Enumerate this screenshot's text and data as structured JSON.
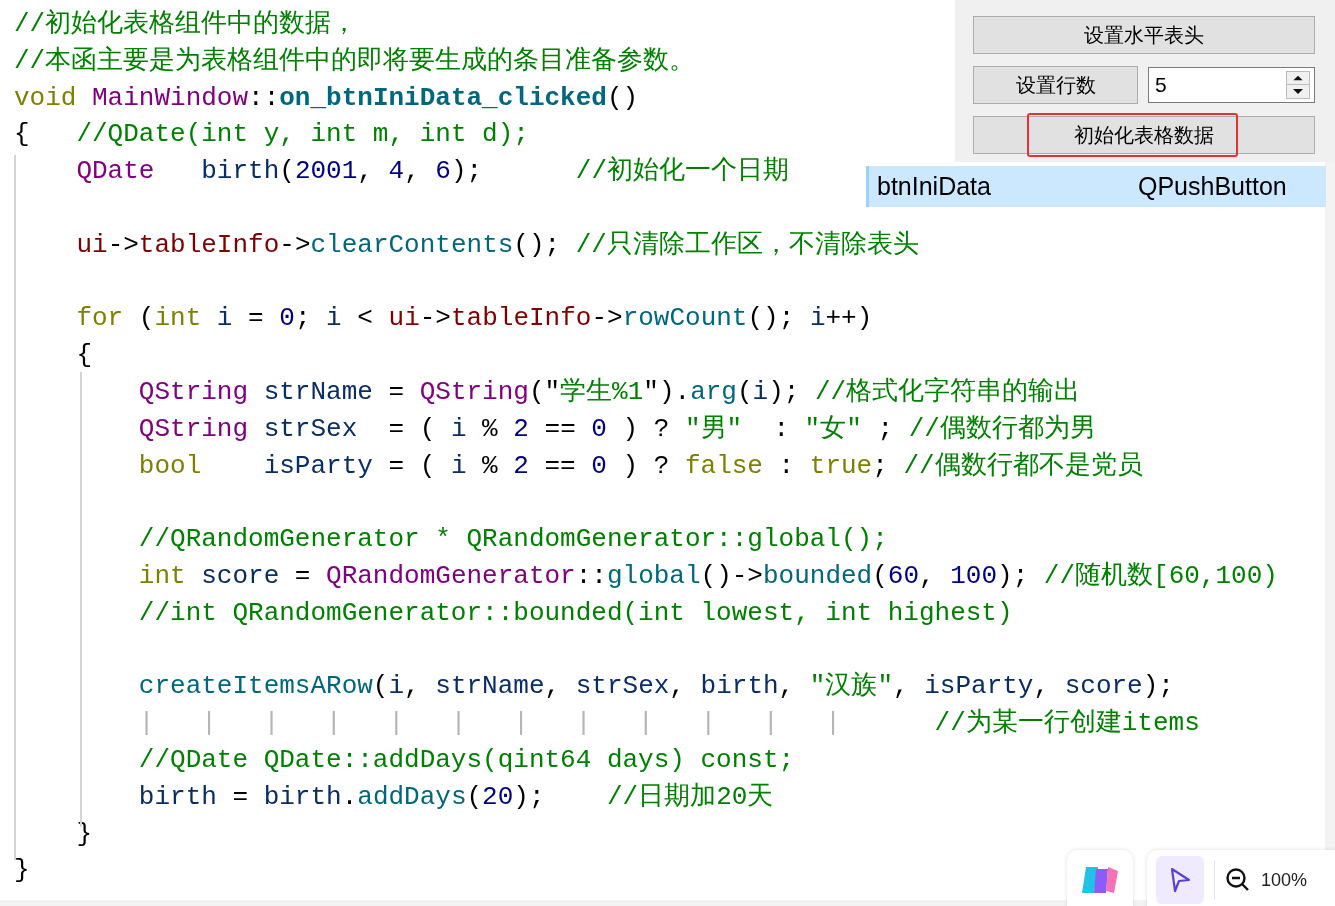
{
  "code": {
    "lines": [
      {
        "kind": "code",
        "tokens": [
          {
            "text": "//初始化表格组件中的数据，",
            "kind": "comment"
          }
        ]
      },
      {
        "kind": "code",
        "tokens": [
          {
            "text": "//本函主要是为表格组件中的即将要生成的条目准备参数。",
            "kind": "comment"
          }
        ]
      },
      {
        "kind": "code",
        "tokens": [
          {
            "text": "void ",
            "kind": "keyword"
          },
          {
            "text": "MainWindow",
            "kind": "type"
          },
          {
            "text": "::",
            "kind": "punct"
          },
          {
            "text": "on_btnIniData_clicked",
            "kind": "boldfunc"
          },
          {
            "text": "()",
            "kind": "punct"
          }
        ]
      },
      {
        "kind": "code",
        "tokens": [
          {
            "text": "{",
            "kind": "punct"
          },
          {
            "text": "   //QDate(int y, int m, int d);",
            "kind": "comment"
          }
        ]
      },
      {
        "kind": "code",
        "tokens": [
          {
            "text": "    QDate",
            "kind": "type"
          },
          {
            "text": "   birth",
            "kind": "var"
          },
          {
            "text": "(",
            "kind": "punct"
          },
          {
            "text": "2001",
            "kind": "number"
          },
          {
            "text": ", ",
            "kind": "punct"
          },
          {
            "text": "4",
            "kind": "number"
          },
          {
            "text": ", ",
            "kind": "punct"
          },
          {
            "text": "6",
            "kind": "number"
          },
          {
            "text": ");      ",
            "kind": "punct"
          },
          {
            "text": "//初始化一个日期",
            "kind": "comment"
          }
        ]
      },
      {
        "kind": "blank"
      },
      {
        "kind": "code",
        "tokens": [
          {
            "text": "    ui",
            "kind": "member"
          },
          {
            "text": "->",
            "kind": "punct"
          },
          {
            "text": "tableInfo",
            "kind": "member"
          },
          {
            "text": "->",
            "kind": "punct"
          },
          {
            "text": "clearContents",
            "kind": "func"
          },
          {
            "text": "(); ",
            "kind": "punct"
          },
          {
            "text": "//只清除工作区，不清除表头",
            "kind": "comment"
          }
        ]
      },
      {
        "kind": "blank"
      },
      {
        "kind": "code",
        "tokens": [
          {
            "text": "    for ",
            "kind": "keyword"
          },
          {
            "text": "(",
            "kind": "punct"
          },
          {
            "text": "int ",
            "kind": "keyword"
          },
          {
            "text": "i",
            "kind": "var"
          },
          {
            "text": " = ",
            "kind": "punct"
          },
          {
            "text": "0",
            "kind": "number"
          },
          {
            "text": "; ",
            "kind": "punct"
          },
          {
            "text": "i",
            "kind": "var"
          },
          {
            "text": " < ",
            "kind": "punct"
          },
          {
            "text": "ui",
            "kind": "member"
          },
          {
            "text": "->",
            "kind": "punct"
          },
          {
            "text": "tableInfo",
            "kind": "member"
          },
          {
            "text": "->",
            "kind": "punct"
          },
          {
            "text": "rowCount",
            "kind": "func"
          },
          {
            "text": "(); ",
            "kind": "punct"
          },
          {
            "text": "i",
            "kind": "var"
          },
          {
            "text": "++)",
            "kind": "punct"
          }
        ]
      },
      {
        "kind": "code",
        "tokens": [
          {
            "text": "    {",
            "kind": "punct"
          }
        ]
      },
      {
        "kind": "code",
        "tokens": [
          {
            "text": "        QString ",
            "kind": "type"
          },
          {
            "text": "strName",
            "kind": "var"
          },
          {
            "text": " = ",
            "kind": "punct"
          },
          {
            "text": "QString",
            "kind": "type"
          },
          {
            "text": "(\"",
            "kind": "punct"
          },
          {
            "text": "学生%1",
            "kind": "string"
          },
          {
            "text": "\").",
            "kind": "punct"
          },
          {
            "text": "arg",
            "kind": "func"
          },
          {
            "text": "(",
            "kind": "punct"
          },
          {
            "text": "i",
            "kind": "var"
          },
          {
            "text": "); ",
            "kind": "punct"
          },
          {
            "text": "//格式化字符串的输出",
            "kind": "comment"
          }
        ]
      },
      {
        "kind": "code",
        "tokens": [
          {
            "text": "        QString ",
            "kind": "type"
          },
          {
            "text": "strSex",
            "kind": "var"
          },
          {
            "text": "  = ( ",
            "kind": "punct"
          },
          {
            "text": "i",
            "kind": "var"
          },
          {
            "text": " % ",
            "kind": "punct"
          },
          {
            "text": "2",
            "kind": "number"
          },
          {
            "text": " == ",
            "kind": "punct"
          },
          {
            "text": "0",
            "kind": "number"
          },
          {
            "text": " ) ? ",
            "kind": "punct"
          },
          {
            "text": "\"男\"",
            "kind": "string"
          },
          {
            "text": "  : ",
            "kind": "punct"
          },
          {
            "text": "\"女\"",
            "kind": "string"
          },
          {
            "text": " ; ",
            "kind": "punct"
          },
          {
            "text": "//偶数行都为男",
            "kind": "comment"
          }
        ]
      },
      {
        "kind": "code",
        "tokens": [
          {
            "text": "        bool    ",
            "kind": "keyword"
          },
          {
            "text": "isParty",
            "kind": "var"
          },
          {
            "text": " = ( ",
            "kind": "punct"
          },
          {
            "text": "i",
            "kind": "var"
          },
          {
            "text": " % ",
            "kind": "punct"
          },
          {
            "text": "2",
            "kind": "number"
          },
          {
            "text": " == ",
            "kind": "punct"
          },
          {
            "text": "0",
            "kind": "number"
          },
          {
            "text": " ) ? ",
            "kind": "punct"
          },
          {
            "text": "false",
            "kind": "keyword"
          },
          {
            "text": " : ",
            "kind": "punct"
          },
          {
            "text": "true",
            "kind": "keyword"
          },
          {
            "text": "; ",
            "kind": "punct"
          },
          {
            "text": "//偶数行都不是党员",
            "kind": "comment"
          }
        ]
      },
      {
        "kind": "blank"
      },
      {
        "kind": "code",
        "tokens": [
          {
            "text": "        //QRandomGenerator * QRandomGenerator::global();",
            "kind": "comment"
          }
        ]
      },
      {
        "kind": "code",
        "tokens": [
          {
            "text": "        int ",
            "kind": "keyword"
          },
          {
            "text": "score",
            "kind": "var"
          },
          {
            "text": " = ",
            "kind": "punct"
          },
          {
            "text": "QRandomGenerator",
            "kind": "type"
          },
          {
            "text": "::",
            "kind": "punct"
          },
          {
            "text": "global",
            "kind": "func"
          },
          {
            "text": "()->",
            "kind": "punct"
          },
          {
            "text": "bounded",
            "kind": "func"
          },
          {
            "text": "(",
            "kind": "punct"
          },
          {
            "text": "60",
            "kind": "number"
          },
          {
            "text": ", ",
            "kind": "punct"
          },
          {
            "text": "100",
            "kind": "number"
          },
          {
            "text": "); ",
            "kind": "punct"
          },
          {
            "text": "//随机数[60,100)",
            "kind": "comment"
          }
        ]
      },
      {
        "kind": "code",
        "tokens": [
          {
            "text": "        //int QRandomGenerator::bounded(int lowest, int highest)",
            "kind": "comment"
          }
        ]
      },
      {
        "kind": "blank"
      },
      {
        "kind": "code",
        "tokens": [
          {
            "text": "        createItemsARow",
            "kind": "func"
          },
          {
            "text": "(",
            "kind": "punct"
          },
          {
            "text": "i",
            "kind": "var"
          },
          {
            "text": ", ",
            "kind": "punct"
          },
          {
            "text": "strName",
            "kind": "var"
          },
          {
            "text": ", ",
            "kind": "punct"
          },
          {
            "text": "strSex",
            "kind": "var"
          },
          {
            "text": ", ",
            "kind": "punct"
          },
          {
            "text": "birth",
            "kind": "var"
          },
          {
            "text": ", ",
            "kind": "punct"
          },
          {
            "text": "\"汉族\"",
            "kind": "string"
          },
          {
            "text": ", ",
            "kind": "punct"
          },
          {
            "text": "isParty",
            "kind": "var"
          },
          {
            "text": ", ",
            "kind": "punct"
          },
          {
            "text": "score",
            "kind": "var"
          },
          {
            "text": ");",
            "kind": "punct"
          }
        ]
      },
      {
        "kind": "code",
        "tokens": [
          {
            "text": "        |   |   |   |   |   |   |   |   |   |   |   |",
            "kind": "guide"
          },
          {
            "text": "      //为某一行创建items",
            "kind": "comment"
          }
        ]
      },
      {
        "kind": "code",
        "tokens": [
          {
            "text": "        //QDate QDate::addDays(qint64 days) const;",
            "kind": "comment"
          }
        ]
      },
      {
        "kind": "code",
        "tokens": [
          {
            "text": "        birth",
            "kind": "var"
          },
          {
            "text": " = ",
            "kind": "punct"
          },
          {
            "text": "birth",
            "kind": "var"
          },
          {
            "text": ".",
            "kind": "punct"
          },
          {
            "text": "addDays",
            "kind": "func"
          },
          {
            "text": "(",
            "kind": "punct"
          },
          {
            "text": "20",
            "kind": "number"
          },
          {
            "text": ");    ",
            "kind": "punct"
          },
          {
            "text": "//日期加20天",
            "kind": "comment"
          }
        ]
      },
      {
        "kind": "code",
        "tokens": [
          {
            "text": "    }",
            "kind": "punct"
          }
        ]
      },
      {
        "kind": "code",
        "tokens": [
          {
            "text": "}",
            "kind": "punct"
          }
        ]
      }
    ]
  },
  "form": {
    "buttons": [
      {
        "label": "设置水平表头",
        "highlighted": false
      }
    ],
    "row_buttons": [
      {
        "label": "设置行数",
        "highlighted": false
      }
    ],
    "spin_box": {
      "value": "5"
    },
    "last_buttons": [
      {
        "label": "初始化表格数据",
        "highlighted": true
      }
    ]
  },
  "object_list": {
    "rows": [
      {
        "name": "btnIniData",
        "class": "QPushButton",
        "selected": true
      }
    ]
  },
  "viewer_toolbar": {
    "zoom": "100%"
  }
}
